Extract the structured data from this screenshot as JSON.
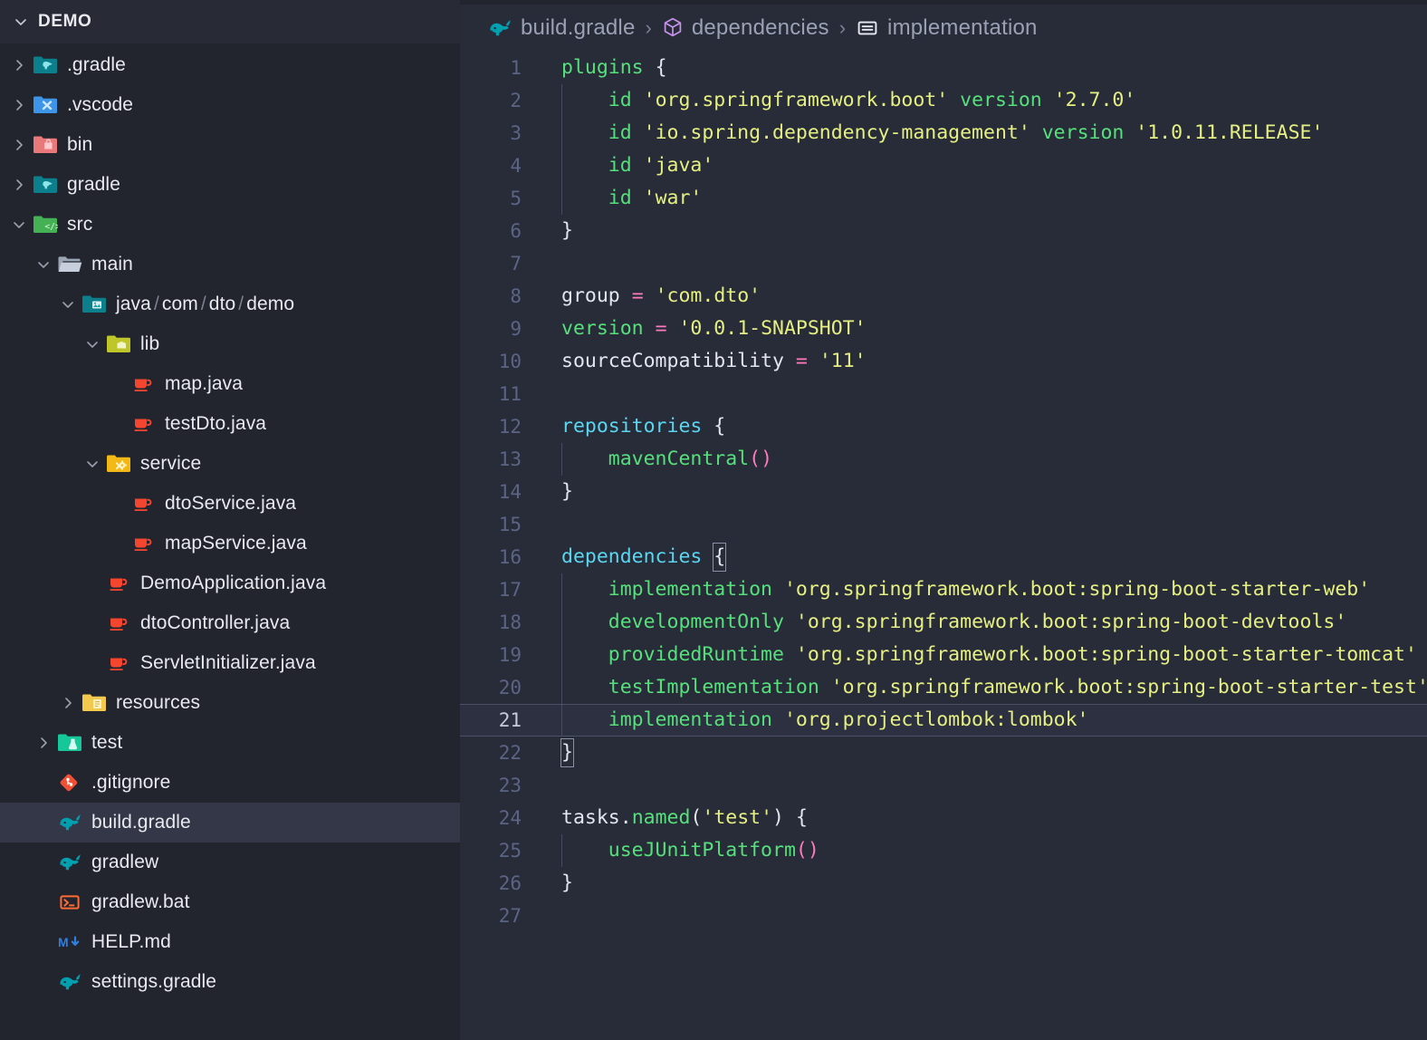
{
  "sidebar": {
    "header": {
      "title": "DEMO",
      "twisty": "chevron-down-icon"
    },
    "items": [
      {
        "label": "gradle",
        "display": ".gradle",
        "depth": 1,
        "twisty": "chevron-right-icon",
        "icon": "folder-gradle-icon",
        "type": "folder",
        "selected": false
      },
      {
        "label": "vscode",
        "display": ".vscode",
        "depth": 1,
        "twisty": "chevron-right-icon",
        "icon": "folder-vscode-icon",
        "type": "folder",
        "selected": false
      },
      {
        "label": "bin",
        "display": "bin",
        "depth": 1,
        "twisty": "chevron-right-icon",
        "icon": "folder-bin-icon",
        "type": "folder",
        "selected": false
      },
      {
        "label": "gradle",
        "display": "gradle",
        "depth": 1,
        "twisty": "chevron-right-icon",
        "icon": "folder-gradle-icon",
        "type": "folder",
        "selected": false
      },
      {
        "label": "src",
        "display": "src",
        "depth": 1,
        "twisty": "chevron-down-icon",
        "icon": "folder-src-icon",
        "type": "folder",
        "selected": false
      },
      {
        "label": "main",
        "display": "main",
        "depth": 2,
        "twisty": "chevron-down-icon",
        "icon": "folder-open-icon",
        "type": "folder",
        "selected": false
      },
      {
        "label": "java/com/dto/demo",
        "display": "java/com/dto/demo",
        "depth": 3,
        "twisty": "chevron-down-icon",
        "icon": "folder-java-icon",
        "type": "folder",
        "selected": false,
        "compound": true
      },
      {
        "label": "lib",
        "display": "lib",
        "depth": 4,
        "twisty": "chevron-down-icon",
        "icon": "folder-lib-icon",
        "type": "folder",
        "selected": false
      },
      {
        "label": "map.java",
        "display": "map.java",
        "depth": 5,
        "twisty": "none",
        "icon": "java-file-icon",
        "type": "file",
        "selected": false
      },
      {
        "label": "testDto.java",
        "display": "testDto.java",
        "depth": 5,
        "twisty": "none",
        "icon": "java-file-icon",
        "type": "file",
        "selected": false
      },
      {
        "label": "service",
        "display": "service",
        "depth": 4,
        "twisty": "chevron-down-icon",
        "icon": "folder-service-icon",
        "type": "folder",
        "selected": false
      },
      {
        "label": "dtoService.java",
        "display": "dtoService.java",
        "depth": 5,
        "twisty": "none",
        "icon": "java-file-icon",
        "type": "file",
        "selected": false
      },
      {
        "label": "mapService.java",
        "display": "mapService.java",
        "depth": 5,
        "twisty": "none",
        "icon": "java-file-icon",
        "type": "file",
        "selected": false
      },
      {
        "label": "DemoApplication.java",
        "display": "DemoApplication.java",
        "depth": 4,
        "twisty": "none",
        "icon": "java-file-icon",
        "type": "file",
        "selected": false
      },
      {
        "label": "dtoController.java",
        "display": "dtoController.java",
        "depth": 4,
        "twisty": "none",
        "icon": "java-file-icon",
        "type": "file",
        "selected": false
      },
      {
        "label": "ServletInitializer.java",
        "display": "ServletInitializer.java",
        "depth": 4,
        "twisty": "none",
        "icon": "java-file-icon",
        "type": "file",
        "selected": false
      },
      {
        "label": "resources",
        "display": "resources",
        "depth": 3,
        "twisty": "chevron-right-icon",
        "icon": "folder-resources-icon",
        "type": "folder",
        "selected": false
      },
      {
        "label": "test",
        "display": "test",
        "depth": 2,
        "twisty": "chevron-right-icon",
        "icon": "folder-test-icon",
        "type": "folder",
        "selected": false
      },
      {
        "label": "gitignore",
        "display": ".gitignore",
        "depth": 2,
        "twisty": "none",
        "icon": "git-icon",
        "type": "file",
        "selected": false
      },
      {
        "label": "build.gradle",
        "display": "build.gradle",
        "depth": 2,
        "twisty": "none",
        "icon": "gradle-icon",
        "type": "file",
        "selected": true
      },
      {
        "label": "gradlew",
        "display": "gradlew",
        "depth": 2,
        "twisty": "none",
        "icon": "gradle-icon",
        "type": "file",
        "selected": false
      },
      {
        "label": "gradlew.bat",
        "display": "gradlew.bat",
        "depth": 2,
        "twisty": "none",
        "icon": "console-icon",
        "type": "file",
        "selected": false
      },
      {
        "label": "HELP.md",
        "display": "HELP.md",
        "depth": 2,
        "twisty": "none",
        "icon": "markdown-icon",
        "type": "file",
        "selected": false
      },
      {
        "label": "settings.gradle",
        "display": "settings.gradle",
        "depth": 2,
        "twisty": "none",
        "icon": "gradle-icon",
        "type": "file",
        "selected": false
      }
    ]
  },
  "breadcrumb": [
    {
      "text": "build.gradle",
      "icon": "gradle-icon"
    },
    {
      "text": "dependencies",
      "icon": "cube-icon"
    },
    {
      "text": "implementation",
      "icon": "field-icon"
    }
  ],
  "breadcrumb_separator": "›",
  "editor": {
    "file": "build.gradle",
    "active_line": 21,
    "total_lines": 27,
    "lines": [
      {
        "n": 1,
        "text": "plugins {"
      },
      {
        "n": 2,
        "text": "    id 'org.springframework.boot' version '2.7.0'"
      },
      {
        "n": 3,
        "text": "    id 'io.spring.dependency-management' version '1.0.11.RELEASE'"
      },
      {
        "n": 4,
        "text": "    id 'java'"
      },
      {
        "n": 5,
        "text": "    id 'war'"
      },
      {
        "n": 6,
        "text": "}"
      },
      {
        "n": 7,
        "text": ""
      },
      {
        "n": 8,
        "text": "group = 'com.dto'"
      },
      {
        "n": 9,
        "text": "version = '0.0.1-SNAPSHOT'"
      },
      {
        "n": 10,
        "text": "sourceCompatibility = '11'"
      },
      {
        "n": 11,
        "text": ""
      },
      {
        "n": 12,
        "text": "repositories {"
      },
      {
        "n": 13,
        "text": "    mavenCentral()"
      },
      {
        "n": 14,
        "text": "}"
      },
      {
        "n": 15,
        "text": ""
      },
      {
        "n": 16,
        "text": "dependencies {"
      },
      {
        "n": 17,
        "text": "    implementation 'org.springframework.boot:spring-boot-starter-web'"
      },
      {
        "n": 18,
        "text": "    developmentOnly 'org.springframework.boot:spring-boot-devtools'"
      },
      {
        "n": 19,
        "text": "    providedRuntime 'org.springframework.boot:spring-boot-starter-tomcat'"
      },
      {
        "n": 20,
        "text": "    testImplementation 'org.springframework.boot:spring-boot-starter-test'"
      },
      {
        "n": 21,
        "text": "    implementation 'org.projectlombok:lombok'"
      },
      {
        "n": 22,
        "text": "}"
      },
      {
        "n": 23,
        "text": ""
      },
      {
        "n": 24,
        "text": "tasks.named('test') {"
      },
      {
        "n": 25,
        "text": "    useJUnitPlatform()"
      },
      {
        "n": 26,
        "text": "}"
      },
      {
        "n": 27,
        "text": ""
      }
    ]
  },
  "colors": {
    "editor_bg": "#282c39",
    "sidebar_bg": "#22242e",
    "selection_bg": "#343747",
    "active_line_bg": "#2c3040",
    "keyword_green": "#56e07b",
    "string_yellow": "#e6ef82",
    "block_cyan": "#5ad6f0",
    "operator_pink": "#ff7bbd",
    "text_default": "#e3e6ee",
    "line_number": "#5b6485",
    "breadcrumb_text": "#9ba0b5",
    "gradle_teal": "#00a0b0",
    "java_red": "#f4452f",
    "cube_purple": "#c792ea"
  }
}
